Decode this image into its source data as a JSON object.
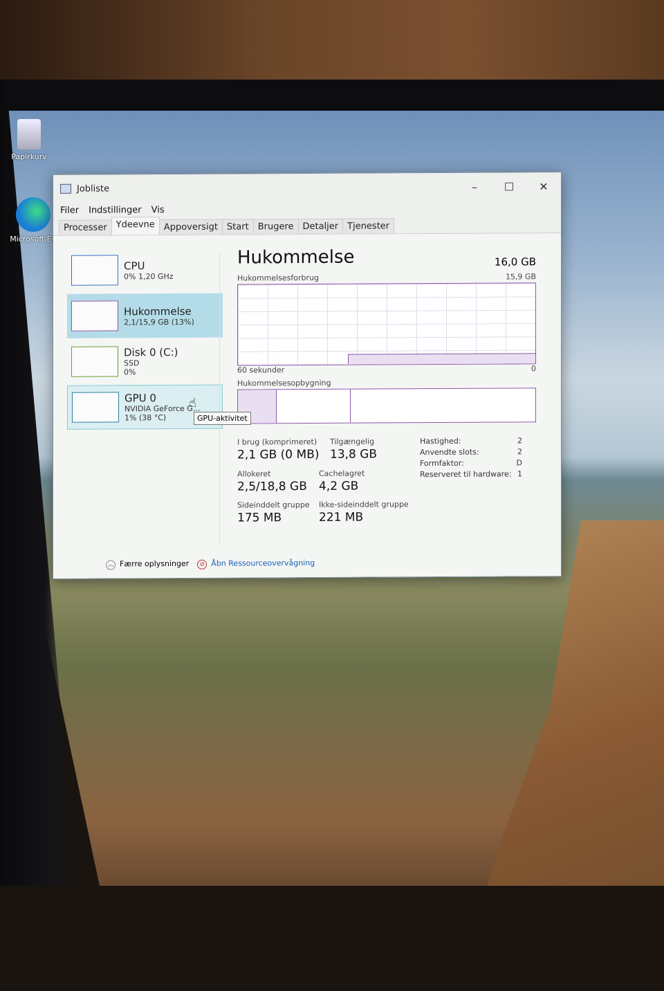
{
  "desktop": {
    "icons": [
      {
        "label": "Papirkurv",
        "icon": "recycle-bin-icon"
      },
      {
        "label": "Microsoft Ed",
        "icon": "edge-icon"
      }
    ]
  },
  "window": {
    "title": "Jobliste",
    "menu": [
      "Filer",
      "Indstillinger",
      "Vis"
    ],
    "tabs": [
      "Processer",
      "Ydeevne",
      "Appoversigt",
      "Start",
      "Brugere",
      "Detaljer",
      "Tjenester"
    ],
    "active_tab": "Ydeevne",
    "sidebar": [
      {
        "title": "CPU",
        "sub1": "0% 1,20 GHz",
        "sub2": "",
        "color": "#3a6fc0"
      },
      {
        "title": "Hukommelse",
        "sub1": "2,1/15,9 GB (13%)",
        "sub2": "",
        "color": "#8a58a8",
        "selected": true
      },
      {
        "title": "Disk 0 (C:)",
        "sub1": "SSD",
        "sub2": "0%",
        "color": "#6aa02a"
      },
      {
        "title": "GPU 0",
        "sub1": "NVIDIA GeForce G...",
        "sub2": "1% (38 °C)",
        "color": "#2a80a0"
      }
    ],
    "tooltip": "GPU-aktivitet",
    "main": {
      "title": "Hukommelse",
      "total": "16,0 GB",
      "usage_label": "Hukommelsesforbrug",
      "usage_max": "15,9 GB",
      "time_label": "60 sekunder",
      "zero": "0",
      "composition_label": "Hukommelsesopbygning",
      "usage_percent": 13,
      "stats": [
        {
          "label": "I brug (komprimeret)",
          "value": "2,1 GB (0 MB)"
        },
        {
          "label": "Tilgængelig",
          "value": "13,8 GB"
        },
        {
          "label": "Allokeret",
          "value": "2,5/18,8 GB"
        },
        {
          "label": "Cachelagret",
          "value": "4,2 GB"
        },
        {
          "label": "Sideinddelt gruppe",
          "value": "175 MB"
        },
        {
          "label": "Ikke-sideinddelt gruppe",
          "value": "221 MB"
        }
      ],
      "kv": [
        {
          "k": "Hastighed:",
          "v": "2"
        },
        {
          "k": "Anvendte slots:",
          "v": "2"
        },
        {
          "k": "Formfaktor:",
          "v": "D"
        },
        {
          "k": "Reserveret til hardware:",
          "v": "1"
        }
      ]
    },
    "footer": {
      "fewer": "Færre oplysninger",
      "resmon": "Åbn Ressourceovervågning"
    }
  }
}
